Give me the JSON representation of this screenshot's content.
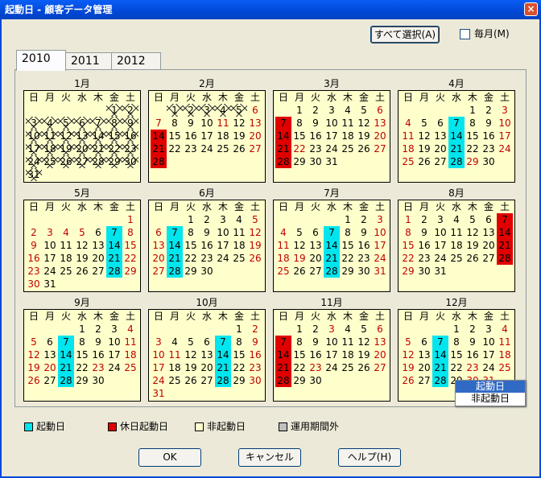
{
  "window": {
    "title": "起動日 - 顧客データ管理",
    "close": "×"
  },
  "toolbar": {
    "select_all": "すべて選択(A)",
    "monthly_label": "毎月(M)"
  },
  "tabs": [
    {
      "label": "2010"
    },
    {
      "label": "2011"
    },
    {
      "label": "2012"
    }
  ],
  "weekdays": [
    "日",
    "月",
    "火",
    "水",
    "木",
    "金",
    "土"
  ],
  "months": [
    {
      "title": "1月",
      "first": 5,
      "days": 31,
      "starts": [],
      "holidays": [],
      "reds": [],
      "hatched": true
    },
    {
      "title": "2月",
      "first": 1,
      "days": 28,
      "starts": [],
      "holidays": [
        14,
        21,
        28
      ],
      "reds": [
        6,
        7,
        11,
        13,
        20,
        27
      ],
      "hatched_until": 6
    },
    {
      "title": "3月",
      "first": 1,
      "days": 31,
      "starts": [],
      "holidays": [
        7,
        14,
        21,
        28
      ],
      "reds": [
        6,
        13,
        20,
        22,
        27
      ]
    },
    {
      "title": "4月",
      "first": 4,
      "days": 30,
      "starts": [
        7,
        14,
        21,
        28
      ],
      "holidays": [],
      "reds": [
        3,
        4,
        10,
        11,
        17,
        18,
        24,
        25,
        29
      ]
    },
    {
      "title": "5月",
      "first": 6,
      "days": 31,
      "starts": [
        7,
        14,
        21,
        28
      ],
      "holidays": [],
      "reds": [
        1,
        2,
        3,
        4,
        5,
        8,
        9,
        15,
        16,
        22,
        23,
        29,
        30
      ]
    },
    {
      "title": "6月",
      "first": 2,
      "days": 30,
      "starts": [
        7,
        14,
        21,
        28
      ],
      "holidays": [],
      "reds": [
        5,
        6,
        12,
        13,
        19,
        20,
        26,
        27
      ]
    },
    {
      "title": "7月",
      "first": 4,
      "days": 31,
      "starts": [
        7,
        14,
        21,
        28
      ],
      "holidays": [],
      "reds": [
        3,
        4,
        10,
        11,
        17,
        18,
        19,
        24,
        25,
        31
      ]
    },
    {
      "title": "8月",
      "first": 0,
      "days": 31,
      "starts": [],
      "holidays": [
        7,
        14,
        21,
        28
      ],
      "reds": [
        1,
        8,
        15,
        22,
        29
      ]
    },
    {
      "title": "9月",
      "first": 3,
      "days": 30,
      "starts": [
        7,
        14,
        21,
        28
      ],
      "holidays": [],
      "reds": [
        4,
        5,
        11,
        12,
        18,
        19,
        20,
        23,
        25,
        26
      ]
    },
    {
      "title": "10月",
      "first": 5,
      "days": 31,
      "starts": [
        7,
        14,
        21,
        28
      ],
      "holidays": [],
      "reds": [
        2,
        3,
        9,
        10,
        11,
        16,
        17,
        23,
        24,
        30,
        31
      ]
    },
    {
      "title": "11月",
      "first": 1,
      "days": 30,
      "starts": [],
      "holidays": [
        7,
        14,
        21,
        28
      ],
      "reds": [
        3,
        6,
        13,
        20,
        23,
        27
      ]
    },
    {
      "title": "12月",
      "first": 3,
      "days": 31,
      "starts": [
        7,
        14,
        21,
        28
      ],
      "holidays": [],
      "reds": [
        4,
        5,
        11,
        12,
        18,
        19,
        23,
        25,
        26,
        30,
        31
      ]
    }
  ],
  "legend": [
    {
      "label": "起動日",
      "color": "#00e5ee"
    },
    {
      "label": "休日起動日",
      "color": "#e00000"
    },
    {
      "label": "非起動日",
      "color": "#ffffcc"
    },
    {
      "label": "運用期間外",
      "color": "#c0c0c0"
    }
  ],
  "buttons": {
    "ok": "OK",
    "cancel": "キャンセル",
    "help": "ヘルプ(H)"
  },
  "context_menu": {
    "items": [
      "起動日",
      "非起動日"
    ],
    "selected": 0
  }
}
